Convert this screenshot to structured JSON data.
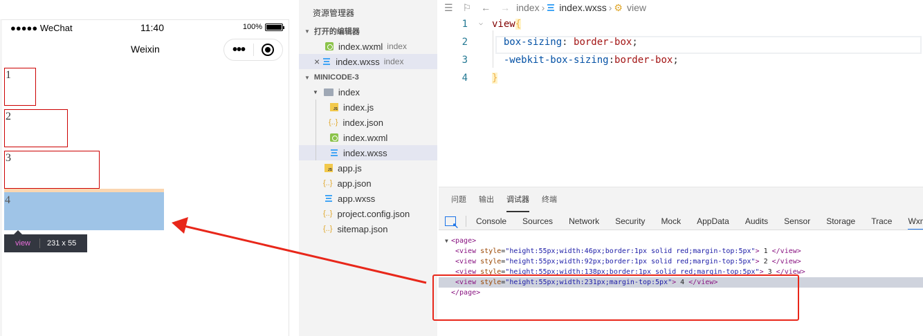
{
  "simulator": {
    "status": {
      "carrier": "●●●●● WeChat",
      "time": "11:40",
      "battery": "100%"
    },
    "nav_title": "Weixin",
    "capsule_dots": "•••",
    "boxes": [
      "1",
      "2",
      "3"
    ],
    "highlight_text": "4",
    "tooltip": {
      "tag": "view",
      "dims": "231 x 55"
    }
  },
  "explorer": {
    "title": "资源管理器",
    "open_editors_label": "打开的编辑器",
    "open_editors": [
      {
        "name": "index.wxml",
        "desc": "index",
        "icon": "wxml-icon"
      },
      {
        "name": "index.wxss",
        "desc": "index",
        "icon": "wxss-icon"
      }
    ],
    "project_label": "MINICODE-3",
    "folder": "index",
    "folder_files": [
      "index.js",
      "index.json",
      "index.wxml",
      "index.wxss"
    ],
    "root_files": [
      "app.js",
      "app.json",
      "app.wxss",
      "project.config.json",
      "sitemap.json"
    ]
  },
  "editor": {
    "breadcrumb": {
      "folder": "index",
      "file": "index.wxss",
      "symbol": "view"
    },
    "lines": [
      {
        "num": "1",
        "selector": "view",
        "brace": "{"
      },
      {
        "num": "2",
        "prop": "box-sizing",
        "sep": ": ",
        "val": "border-box",
        "end": ";"
      },
      {
        "num": "3",
        "prop": "-webkit-box-sizing",
        "sep": ":",
        "val": "border-box",
        "end": ";"
      },
      {
        "num": "4",
        "brace": "}"
      }
    ]
  },
  "debugger": {
    "panel_tabs": [
      "问题",
      "输出",
      "调试器",
      "终端"
    ],
    "active_panel_tab": "调试器",
    "dev_tabs": [
      "Console",
      "Sources",
      "Network",
      "Security",
      "Mock",
      "AppData",
      "Audits",
      "Sensor",
      "Storage",
      "Trace",
      "Wxml"
    ],
    "active_dev_tab": "Wxml",
    "dom": {
      "page_open": "<page>",
      "page_close": "</page>",
      "views": [
        {
          "style": "height:55px;width:46px;border:1px solid red;margin-top:5px",
          "text": " 1 "
        },
        {
          "style": "height:55px;width:92px;border:1px solid red;margin-top:5px",
          "text": " 2 "
        },
        {
          "style": "height:55px;width:138px;border:1px solid red;margin-top:5px",
          "text": " 3 "
        },
        {
          "style": "height:55px;width:231px;margin-top:5px",
          "text": " 4 "
        }
      ]
    }
  },
  "colors": {
    "annotation": "#e8271a",
    "highlight": "#9fc4e7",
    "margin": "#f9cc9d"
  }
}
